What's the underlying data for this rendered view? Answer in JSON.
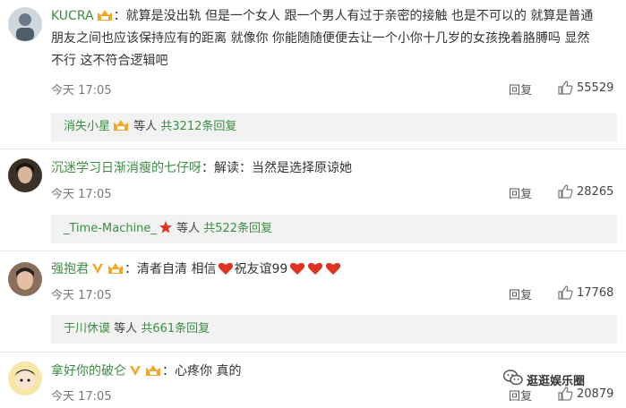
{
  "comments": [
    {
      "user": "KUCRA",
      "lines": [
        "：就算是没出轨 但是一个女人 跟一个男人有过于亲密的接触 也是不可以的 就算是普通",
        "朋友之间也应该保持应有的距离 就像你 你能随随便便去让一个小你十几岁的女孩挽着胳膊吗 显然",
        "不行 这不符合逻辑吧"
      ],
      "time": "今天 17:05",
      "reply_label": "回复",
      "likes": "55529",
      "replies": {
        "user": "消失小星",
        "middle": "等人",
        "count": "共3212条回复"
      }
    },
    {
      "user": "沉迷学习日渐消瘦的七仔呀",
      "lines": [
        "：解读：当然是选择原谅她"
      ],
      "time": "今天 17:05",
      "reply_label": "回复",
      "likes": "28265",
      "replies": {
        "user": "_Time-Machine_",
        "middle": "等人",
        "count": "共522条回复"
      }
    },
    {
      "user": "强抱君",
      "text_a": "：清者自清 相信",
      "text_b": "祝友谊99",
      "time": "今天 17:05",
      "reply_label": "回复",
      "likes": "17768",
      "replies": {
        "user": "于川休谟",
        "middle": "等人",
        "count": "共661条回复"
      }
    },
    {
      "user": "拿好你的破仑",
      "lines": [
        "：心疼你 真的"
      ],
      "time": "今天 17:05",
      "reply_label": "回复",
      "likes": "20879"
    }
  ],
  "watermark": "逛逛娱乐圈",
  "colors": {
    "username": "#3b8f43",
    "reply_bg": "#f2f2f2",
    "badge": "#f5a623",
    "heart": "#e0331f",
    "star": "#e0331f"
  }
}
